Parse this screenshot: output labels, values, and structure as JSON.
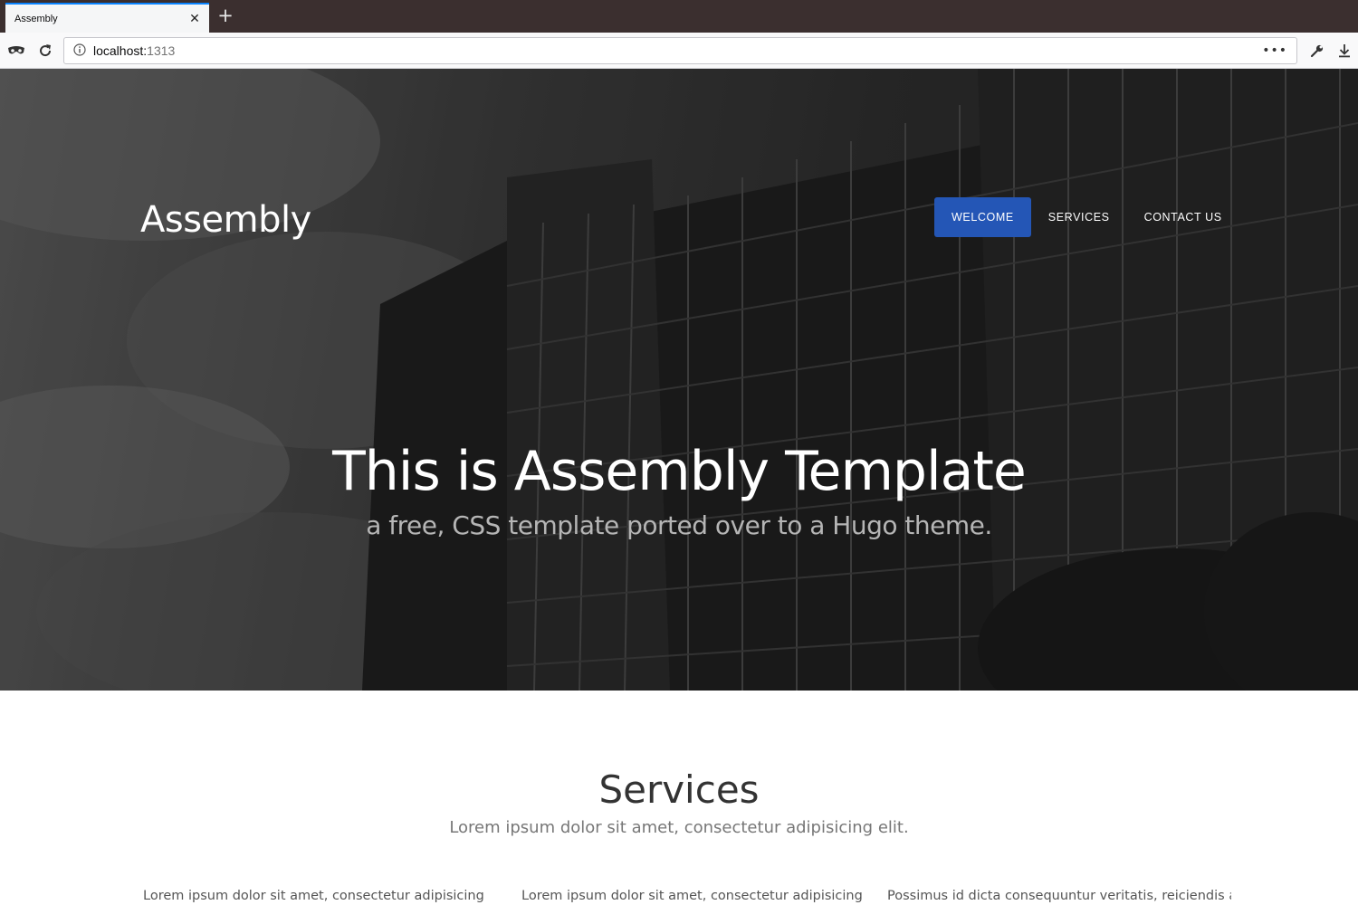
{
  "browser": {
    "tab_title": "Assembly",
    "tab_close_icon": "close-icon",
    "new_tab_icon": "plus-icon",
    "url_host": "localhost:",
    "url_port": "1313",
    "more_icon": "ellipsis-icon",
    "tools_icon": "wrench-icon",
    "download_icon": "download-icon"
  },
  "site": {
    "brand": "Assembly",
    "menu": [
      {
        "label": "WELCOME",
        "active": true
      },
      {
        "label": "SERVICES",
        "active": false
      },
      {
        "label": "CONTACT US",
        "active": false
      }
    ],
    "accent_color": "#2456b6"
  },
  "hero": {
    "title": "This is Assembly Template",
    "subtitle": "a free, CSS template ported over to a Hugo theme."
  },
  "services": {
    "title": "Services",
    "subtitle": "Lorem ipsum dolor sit amet, consectetur adipisicing elit.",
    "columns": [
      "Lorem ipsum dolor sit amet, consectetur adipisicing elit.",
      "Lorem ipsum dolor sit amet, consectetur adipisicing",
      "Possimus id dicta consequuntur veritatis, reiciendis at"
    ]
  }
}
